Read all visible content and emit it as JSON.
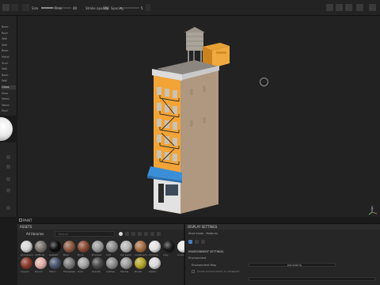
{
  "toolbar": {
    "size_label": "Size",
    "flow_label": "Flow",
    "stroke_opacity_label": "Stroke opacity",
    "spacing_label": "Spacing",
    "size_value": "40",
    "flow_value": "100",
    "stroke_opacity_value": "100",
    "spacing_value": "5",
    "icons": [
      "brush-icon",
      "symmetry-icon",
      "camera-icon",
      "settings-icon",
      "share-icon",
      "record-icon",
      "screenshot-icon",
      "window-icon"
    ]
  },
  "layers": {
    "items": [
      "Base",
      "Roof",
      "Wall",
      "Wall",
      "Base",
      "Metal",
      "Stair",
      "Wall",
      "Base",
      "Wall",
      "Glass",
      "Door",
      "Metal",
      "Wood",
      "Roof",
      "Sign",
      "Base"
    ]
  },
  "viewport": {
    "mode_label": "PAINT",
    "axis_label": "Y"
  },
  "assets": {
    "title": "ASSETS",
    "library_label": "All libraries",
    "search_placeholder": "Search",
    "materials_row1": [
      "Aluminium",
      "Artificial",
      "Asphalt",
      "Bark",
      "Brick",
      "Brushed",
      "Calf",
      "Car paint",
      "Cardboard",
      "Chrome",
      "Clay",
      "Concrete"
    ],
    "materials_row2": [
      "Copper",
      "Denim",
      "Fabric",
      "Fiberglass",
      "Gold",
      "Granite",
      "Leather",
      "Marble",
      "Nickel",
      "Plastic"
    ],
    "colors_row1": [
      "#d6d6d6",
      "#7a7470",
      "#0f0f0f",
      "#8c5a42",
      "#8b4a33",
      "#9a9a9a",
      "#8d8d8d",
      "#b5b5b5",
      "#a86f45",
      "#e2e2e2",
      "#1a1a1a",
      "#e8e8e8"
    ],
    "colors_row2": [
      "#8a3a2b",
      "#e0b0a8",
      "#4a556e",
      "#7a7a7a",
      "#a2a2a2",
      "#4a4a4a",
      "#8c8c8c",
      "#9c9c9c",
      "#b4a52a",
      "#d9d9d9"
    ]
  },
  "display": {
    "title": "DISPLAY SETTINGS",
    "tab_label": "Shot mode - Material",
    "section_label": "ENVIRONMENT SETTINGS",
    "environment_label": "Environment",
    "env_map_label": "Environment Map",
    "env_map_value": "panorama",
    "checkbox_label": "Show environment in viewport"
  },
  "colors": {
    "accent": "#f0a030",
    "awning": "#3a8fd8"
  }
}
